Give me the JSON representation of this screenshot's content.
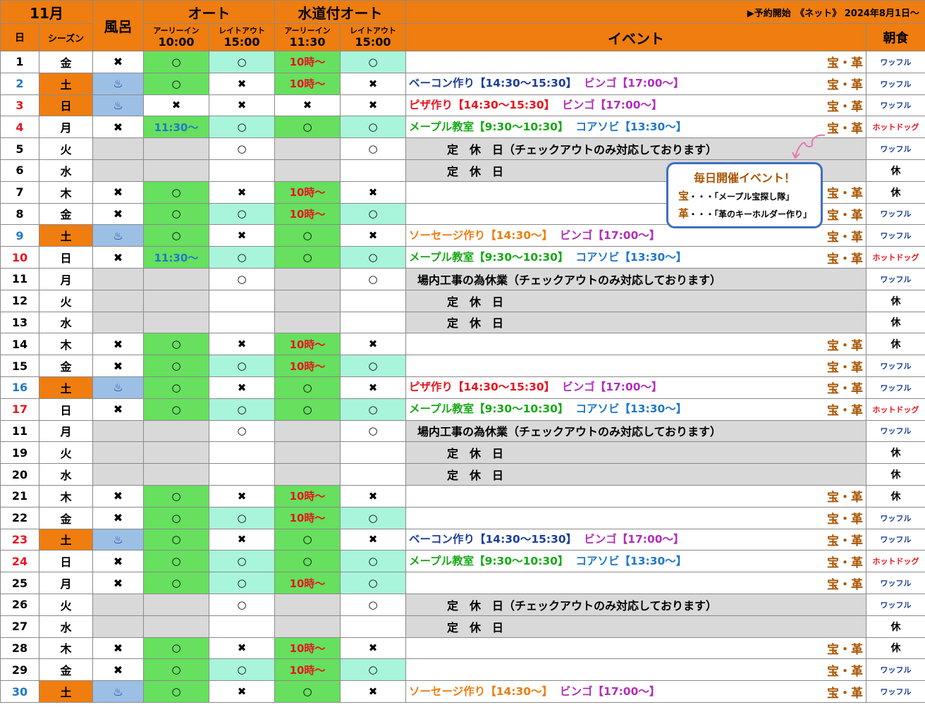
{
  "header": {
    "month": "11月",
    "day_label": "日",
    "season_label": "シーズン",
    "bath_label": "風呂",
    "auto_label": "オート",
    "water_auto_label": "水道付オート",
    "early_in": "アーリーイン",
    "late_out": "レイトアウト",
    "auto_early_time": "10:00",
    "auto_late_time": "15:00",
    "water_early_time": "11:30",
    "water_late_time": "15:00",
    "sale_notice": "▶予約開始　《ネット》 2024年8月1日～",
    "event_label": "イベント",
    "breakfast_label": "朝食"
  },
  "callout": {
    "title": "毎日開催イベント！",
    "line1_key": "宝",
    "line1_text": "・・・「メープル宝探し隊」",
    "line2_key": "革",
    "line2_text": "・・・「革のキーホルダー作り」"
  },
  "colors": {
    "header_orange": "#ef7d0f",
    "open_green": "#66e05e",
    "open_mint": "#a8f5dc",
    "bath_blue": "#9cbfe6",
    "closed_gray": "#d9d9d9"
  },
  "rows": [
    {
      "day": "1",
      "wd": "金",
      "day_color": "black",
      "season": "w",
      "bath": "✖",
      "bath_bg": "w",
      "ae": "○",
      "ae_bg": "green",
      "al": "○",
      "al_bg": "mint",
      "we": "10時～",
      "we_bg": "green",
      "wl": "○",
      "wl_bg": "mint",
      "ev": [],
      "mark": "宝・革",
      "bf": "ワッフル",
      "bf_type": "w"
    },
    {
      "day": "2",
      "wd": "土",
      "day_color": "blue",
      "season": "orange",
      "bath": "♨",
      "bath_bg": "blue",
      "ae": "○",
      "ae_bg": "green",
      "al": "✖",
      "al_bg": "w",
      "we": "10時～",
      "we_bg": "green",
      "wl": "✖",
      "wl_bg": "w",
      "ev": [
        {
          "t": "ベーコン作り【14:30～15:30】",
          "c": "e-blue"
        },
        {
          "t": "ビンゴ【17:00～】",
          "c": "e-purple"
        }
      ],
      "mark": "宝・革",
      "bf": "ワッフル",
      "bf_type": "w"
    },
    {
      "day": "3",
      "wd": "日",
      "day_color": "red",
      "season": "orange",
      "bath": "♨",
      "bath_bg": "blue",
      "ae": "✖",
      "ae_bg": "w",
      "al": "✖",
      "al_bg": "w",
      "we": "✖",
      "we_bg": "w",
      "wl": "✖",
      "wl_bg": "w",
      "ev": [
        {
          "t": "ピザ作り【14:30～15:30】",
          "c": "e-red"
        },
        {
          "t": "ビンゴ【17:00～】",
          "c": "e-purple"
        }
      ],
      "mark": "宝・革",
      "bf": "ワッフル",
      "bf_type": "w"
    },
    {
      "day": "4",
      "wd": "月",
      "day_color": "red",
      "season": "w",
      "bath": "✖",
      "bath_bg": "w",
      "ae": "11:30～",
      "ae_bg": "green",
      "al": "○",
      "al_bg": "mint",
      "we": "○",
      "we_bg": "green",
      "wl": "○",
      "wl_bg": "mint",
      "ev": [
        {
          "t": "メープル教室【9:30～10:30】",
          "c": "e-green"
        },
        {
          "t": "コアソビ【13:30～】",
          "c": "e-cyan"
        }
      ],
      "mark": "宝・革",
      "bf": "ホットドッグ",
      "bf_type": "h"
    },
    {
      "day": "5",
      "wd": "火",
      "day_color": "black",
      "closed": true,
      "al": "○",
      "wl": "○",
      "closed_text": "定　休　日（チェックアウトのみ対応しております）",
      "closed_indent": true,
      "bf": "ワッフル",
      "bf_type": "w"
    },
    {
      "day": "6",
      "wd": "水",
      "day_color": "black",
      "closed": true,
      "al": "",
      "wl": "",
      "closed_text": "定　休　日",
      "closed_indent": true,
      "bf": "休",
      "bf_type": "k"
    },
    {
      "day": "7",
      "wd": "木",
      "day_color": "black",
      "season": "w",
      "bath": "✖",
      "bath_bg": "w",
      "ae": "○",
      "ae_bg": "green",
      "al": "✖",
      "al_bg": "w",
      "we": "10時～",
      "we_bg": "green",
      "wl": "✖",
      "wl_bg": "w",
      "ev": [],
      "mark": "宝・革",
      "bf": "休",
      "bf_type": "k"
    },
    {
      "day": "8",
      "wd": "金",
      "day_color": "black",
      "season": "w",
      "bath": "✖",
      "bath_bg": "w",
      "ae": "○",
      "ae_bg": "green",
      "al": "○",
      "al_bg": "mint",
      "we": "10時～",
      "we_bg": "green",
      "wl": "○",
      "wl_bg": "mint",
      "ev": [],
      "mark": "宝・革",
      "bf": "ワッフル",
      "bf_type": "w"
    },
    {
      "day": "9",
      "wd": "土",
      "day_color": "blue",
      "season": "orange",
      "bath": "♨",
      "bath_bg": "blue",
      "ae": "○",
      "ae_bg": "green",
      "al": "✖",
      "al_bg": "w",
      "we": "○",
      "we_bg": "green",
      "wl": "✖",
      "wl_bg": "w",
      "ev": [
        {
          "t": "ソーセージ作り【14:30～】",
          "c": "e-orange"
        },
        {
          "t": "ビンゴ【17:00～】",
          "c": "e-purple"
        }
      ],
      "mark": "宝・革",
      "bf": "ワッフル",
      "bf_type": "w"
    },
    {
      "day": "10",
      "wd": "日",
      "day_color": "red",
      "season": "w",
      "bath": "✖",
      "bath_bg": "w",
      "ae": "11:30～",
      "ae_bg": "green",
      "al": "○",
      "al_bg": "mint",
      "we": "○",
      "we_bg": "green",
      "wl": "○",
      "wl_bg": "mint",
      "ev": [
        {
          "t": "メープル教室【9:30～10:30】",
          "c": "e-green"
        },
        {
          "t": "コアソビ【13:30～】",
          "c": "e-cyan"
        }
      ],
      "mark": "宝・革",
      "bf": "ホットドッグ",
      "bf_type": "h"
    },
    {
      "day": "11",
      "wd": "月",
      "day_color": "black",
      "closed": true,
      "al": "○",
      "wl": "○",
      "closed_text": "場内工事の為休業（チェックアウトのみ対応しております）",
      "closed_indent": false,
      "bf": "ワッフル",
      "bf_type": "w"
    },
    {
      "day": "12",
      "wd": "火",
      "day_color": "black",
      "closed": true,
      "al": "",
      "wl": "",
      "closed_text": "定　休　日",
      "closed_indent": true,
      "bf": "休",
      "bf_type": "k"
    },
    {
      "day": "13",
      "wd": "水",
      "day_color": "black",
      "closed": true,
      "al": "",
      "wl": "",
      "closed_text": "定　休　日",
      "closed_indent": true,
      "bf": "休",
      "bf_type": "k"
    },
    {
      "day": "14",
      "wd": "木",
      "day_color": "black",
      "season": "w",
      "bath": "✖",
      "bath_bg": "w",
      "ae": "○",
      "ae_bg": "green",
      "al": "✖",
      "al_bg": "w",
      "we": "10時～",
      "we_bg": "green",
      "wl": "✖",
      "wl_bg": "w",
      "ev": [],
      "mark": "宝・革",
      "bf": "休",
      "bf_type": "k"
    },
    {
      "day": "15",
      "wd": "金",
      "day_color": "black",
      "season": "w",
      "bath": "✖",
      "bath_bg": "w",
      "ae": "○",
      "ae_bg": "green",
      "al": "○",
      "al_bg": "mint",
      "we": "10時～",
      "we_bg": "green",
      "wl": "○",
      "wl_bg": "mint",
      "ev": [],
      "mark": "宝・革",
      "bf": "ワッフル",
      "bf_type": "w"
    },
    {
      "day": "16",
      "wd": "土",
      "day_color": "blue",
      "season": "orange",
      "bath": "♨",
      "bath_bg": "blue",
      "ae": "○",
      "ae_bg": "green",
      "al": "✖",
      "al_bg": "w",
      "we": "○",
      "we_bg": "green",
      "wl": "✖",
      "wl_bg": "w",
      "ev": [
        {
          "t": "ピザ作り【14:30～15:30】",
          "c": "e-red"
        },
        {
          "t": "ビンゴ【17:00～】",
          "c": "e-purple"
        }
      ],
      "mark": "宝・革",
      "bf": "ワッフル",
      "bf_type": "w"
    },
    {
      "day": "17",
      "wd": "日",
      "day_color": "red",
      "season": "w",
      "bath": "✖",
      "bath_bg": "w",
      "ae": "○",
      "ae_bg": "green",
      "al": "○",
      "al_bg": "mint",
      "we": "○",
      "we_bg": "green",
      "wl": "○",
      "wl_bg": "mint",
      "ev": [
        {
          "t": "メープル教室【9:30～10:30】",
          "c": "e-green"
        },
        {
          "t": "コアソビ【13:30～】",
          "c": "e-cyan"
        }
      ],
      "mark": "宝・革",
      "bf": "ホットドッグ",
      "bf_type": "h"
    },
    {
      "day": "11",
      "wd": "月",
      "day_color": "black",
      "closed": true,
      "al": "○",
      "wl": "○",
      "closed_text": "場内工事の為休業（チェックアウトのみ対応しております）",
      "closed_indent": false,
      "bf": "ワッフル",
      "bf_type": "w"
    },
    {
      "day": "19",
      "wd": "火",
      "day_color": "black",
      "closed": true,
      "al": "",
      "wl": "",
      "closed_text": "定　休　日",
      "closed_indent": true,
      "bf": "休",
      "bf_type": "k"
    },
    {
      "day": "20",
      "wd": "水",
      "day_color": "black",
      "closed": true,
      "al": "",
      "wl": "",
      "closed_text": "定　休　日",
      "closed_indent": true,
      "bf": "休",
      "bf_type": "k"
    },
    {
      "day": "21",
      "wd": "木",
      "day_color": "black",
      "season": "w",
      "bath": "✖",
      "bath_bg": "w",
      "ae": "○",
      "ae_bg": "green",
      "al": "✖",
      "al_bg": "w",
      "we": "10時～",
      "we_bg": "green",
      "wl": "✖",
      "wl_bg": "w",
      "ev": [],
      "mark": "宝・革",
      "bf": "休",
      "bf_type": "k"
    },
    {
      "day": "22",
      "wd": "金",
      "day_color": "black",
      "season": "w",
      "bath": "✖",
      "bath_bg": "w",
      "ae": "○",
      "ae_bg": "green",
      "al": "○",
      "al_bg": "mint",
      "we": "10時～",
      "we_bg": "green",
      "wl": "○",
      "wl_bg": "mint",
      "ev": [],
      "mark": "宝・革",
      "bf": "ワッフル",
      "bf_type": "w"
    },
    {
      "day": "23",
      "wd": "土",
      "day_color": "red",
      "season": "orange",
      "bath": "♨",
      "bath_bg": "blue",
      "ae": "○",
      "ae_bg": "green",
      "al": "✖",
      "al_bg": "w",
      "we": "○",
      "we_bg": "green",
      "wl": "✖",
      "wl_bg": "w",
      "ev": [
        {
          "t": "ベーコン作り【14:30～15:30】",
          "c": "e-blue"
        },
        {
          "t": "ビンゴ【17:00～】",
          "c": "e-purple"
        }
      ],
      "mark": "宝・革",
      "bf": "ワッフル",
      "bf_type": "w"
    },
    {
      "day": "24",
      "wd": "日",
      "day_color": "red",
      "season": "w",
      "bath": "✖",
      "bath_bg": "w",
      "ae": "○",
      "ae_bg": "green",
      "al": "○",
      "al_bg": "mint",
      "we": "○",
      "we_bg": "green",
      "wl": "○",
      "wl_bg": "mint",
      "ev": [
        {
          "t": "メープル教室【9:30～10:30】",
          "c": "e-green"
        },
        {
          "t": "コアソビ【13:30～】",
          "c": "e-cyan"
        }
      ],
      "mark": "宝・革",
      "bf": "ホットドッグ",
      "bf_type": "h"
    },
    {
      "day": "25",
      "wd": "月",
      "day_color": "black",
      "season": "w",
      "bath": "✖",
      "bath_bg": "w",
      "ae": "○",
      "ae_bg": "green",
      "al": "○",
      "al_bg": "mint",
      "we": "10時～",
      "we_bg": "green",
      "wl": "○",
      "wl_bg": "mint",
      "ev": [],
      "mark": "宝・革",
      "bf": "ワッフル",
      "bf_type": "w"
    },
    {
      "day": "26",
      "wd": "火",
      "day_color": "black",
      "closed": true,
      "al": "○",
      "wl": "○",
      "closed_text": "定　休　日（チェックアウトのみ対応しております）",
      "closed_indent": true,
      "bf": "ワッフル",
      "bf_type": "w"
    },
    {
      "day": "27",
      "wd": "水",
      "day_color": "black",
      "closed": true,
      "al": "",
      "wl": "",
      "closed_text": "定　休　日",
      "closed_indent": true,
      "bf": "休",
      "bf_type": "k"
    },
    {
      "day": "28",
      "wd": "木",
      "day_color": "black",
      "season": "w",
      "bath": "✖",
      "bath_bg": "w",
      "ae": "○",
      "ae_bg": "green",
      "al": "✖",
      "al_bg": "w",
      "we": "10時～",
      "we_bg": "green",
      "wl": "✖",
      "wl_bg": "w",
      "ev": [],
      "mark": "宝・革",
      "bf": "休",
      "bf_type": "k"
    },
    {
      "day": "29",
      "wd": "金",
      "day_color": "black",
      "season": "w",
      "bath": "✖",
      "bath_bg": "w",
      "ae": "○",
      "ae_bg": "green",
      "al": "○",
      "al_bg": "mint",
      "we": "10時～",
      "we_bg": "green",
      "wl": "○",
      "wl_bg": "mint",
      "ev": [],
      "mark": "宝・革",
      "bf": "ワッフル",
      "bf_type": "w"
    },
    {
      "day": "30",
      "wd": "土",
      "day_color": "blue",
      "season": "orange",
      "bath": "♨",
      "bath_bg": "blue",
      "ae": "○",
      "ae_bg": "green",
      "al": "✖",
      "al_bg": "w",
      "we": "○",
      "we_bg": "green",
      "wl": "✖",
      "wl_bg": "w",
      "ev": [
        {
          "t": "ソーセージ作り【14:30～】",
          "c": "e-orange"
        },
        {
          "t": "ビンゴ【17:00～】",
          "c": "e-purple"
        }
      ],
      "mark": "宝・革",
      "bf": "ワッフル",
      "bf_type": "w"
    }
  ]
}
